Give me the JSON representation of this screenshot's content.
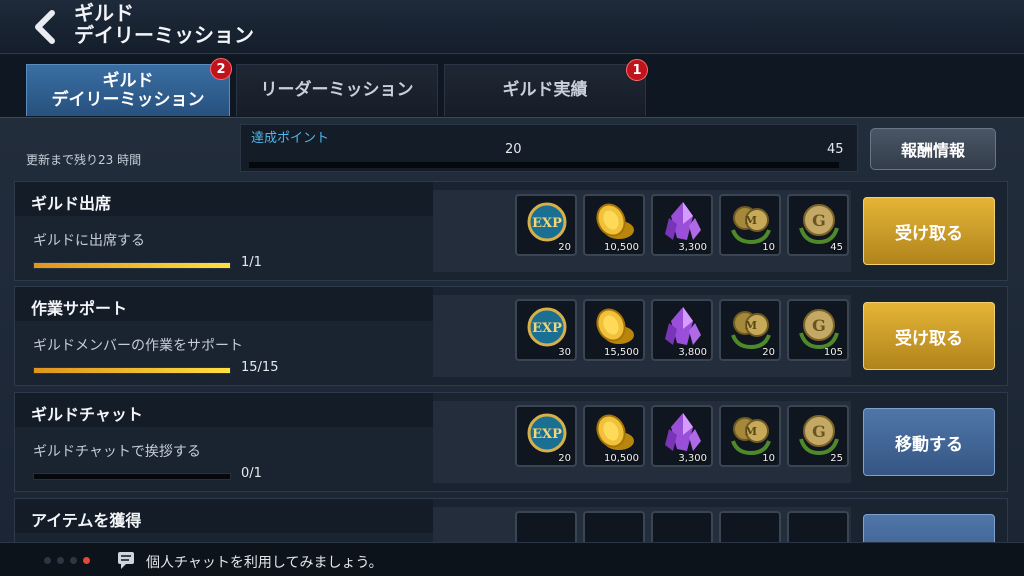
{
  "header": {
    "title_line1": "ギルド",
    "title_line2": "デイリーミッション"
  },
  "tabs": [
    {
      "label_line1": "ギルド",
      "label_line2": "デイリーミッション",
      "badge": "2",
      "active": true
    },
    {
      "label": "リーダーミッション",
      "active": false
    },
    {
      "label": "ギルド実績",
      "badge": "1",
      "active": false
    }
  ],
  "status": {
    "refresh_text": "更新まで残り23 時間"
  },
  "achievement": {
    "label": "達成ポイント",
    "milestone_1": "20",
    "milestone_2": "45",
    "progress_fraction": 0
  },
  "reward_info_button": "報酬情報",
  "missions": [
    {
      "title": "ギルド出席",
      "desc": "ギルドに出席する",
      "count": "1/1",
      "progress": 1.0,
      "rewards": [
        "20",
        "10,500",
        "3,300",
        "10",
        "45"
      ],
      "button": "受け取る",
      "button_style": "gold"
    },
    {
      "title": "作業サポート",
      "desc": "ギルドメンバーの作業をサポート",
      "count": "15/15",
      "progress": 1.0,
      "rewards": [
        "30",
        "15,500",
        "3,800",
        "20",
        "105"
      ],
      "button": "受け取る",
      "button_style": "gold"
    },
    {
      "title": "ギルドチャット",
      "desc": "ギルドチャットで挨拶する",
      "count": "0/1",
      "progress": 0.0,
      "rewards": [
        "20",
        "10,500",
        "3,300",
        "10",
        "25"
      ],
      "button": "移動する",
      "button_style": "blue"
    },
    {
      "title": "アイテムを獲得"
    }
  ],
  "reward_icons": [
    "exp-icon",
    "gold-coin-icon",
    "purple-crystal-icon",
    "medal-coin-icon",
    "guild-coin-icon"
  ],
  "chat": {
    "text": "個人チャットを利用してみましょう。"
  },
  "colors": {
    "accent_blue": "#4fb6ea",
    "gold_button": "#d7a52c",
    "blue_button": "#43679a",
    "badge_red": "#c0141c"
  }
}
